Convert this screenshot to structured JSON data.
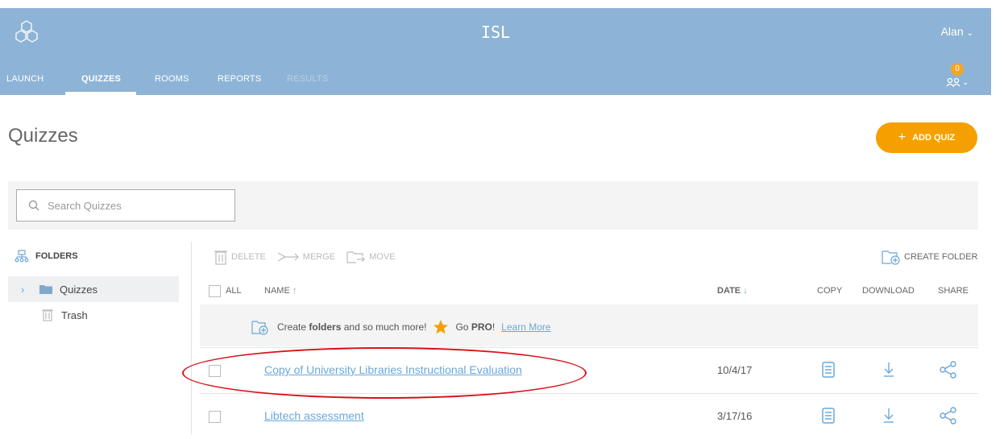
{
  "app": {
    "title": "ISL",
    "user": "Alan",
    "notifications": "0"
  },
  "nav": [
    {
      "label": "LAUNCH",
      "state": "normal"
    },
    {
      "label": "QUIZZES",
      "state": "active"
    },
    {
      "label": "ROOMS",
      "state": "normal"
    },
    {
      "label": "REPORTS",
      "state": "normal"
    },
    {
      "label": "RESULTS",
      "state": "disabled"
    }
  ],
  "page": {
    "title": "Quizzes",
    "add_button": "ADD QUIZ"
  },
  "search": {
    "placeholder": "Search Quizzes",
    "value": ""
  },
  "sidebar": {
    "heading": "FOLDERS",
    "items": [
      {
        "label": "Quizzes",
        "selected": true
      },
      {
        "label": "Trash",
        "selected": false
      }
    ]
  },
  "toolbar": {
    "delete": "DELETE",
    "merge": "MERGE",
    "move": "MOVE",
    "create_folder": "CREATE FOLDER"
  },
  "table": {
    "headers": {
      "all": "ALL",
      "name": "NAME",
      "date": "DATE",
      "copy": "COPY",
      "download": "DOWNLOAD",
      "share": "SHARE"
    },
    "promo": {
      "text1": "Create",
      "bold1": "folders",
      "text2": "and so much more!",
      "text3": "Go",
      "bold2": "PRO",
      "excl": "!",
      "link": "Learn More"
    },
    "rows": [
      {
        "name": "Copy of University Libraries Instructional Evaluation",
        "date": "10/4/17"
      },
      {
        "name": "Libtech assessment",
        "date": "3/17/16"
      }
    ]
  },
  "colors": {
    "topbar": "#8db4d6",
    "accent": "#f5a000",
    "link": "#6aa7d8",
    "annotation": "#d9111b"
  }
}
